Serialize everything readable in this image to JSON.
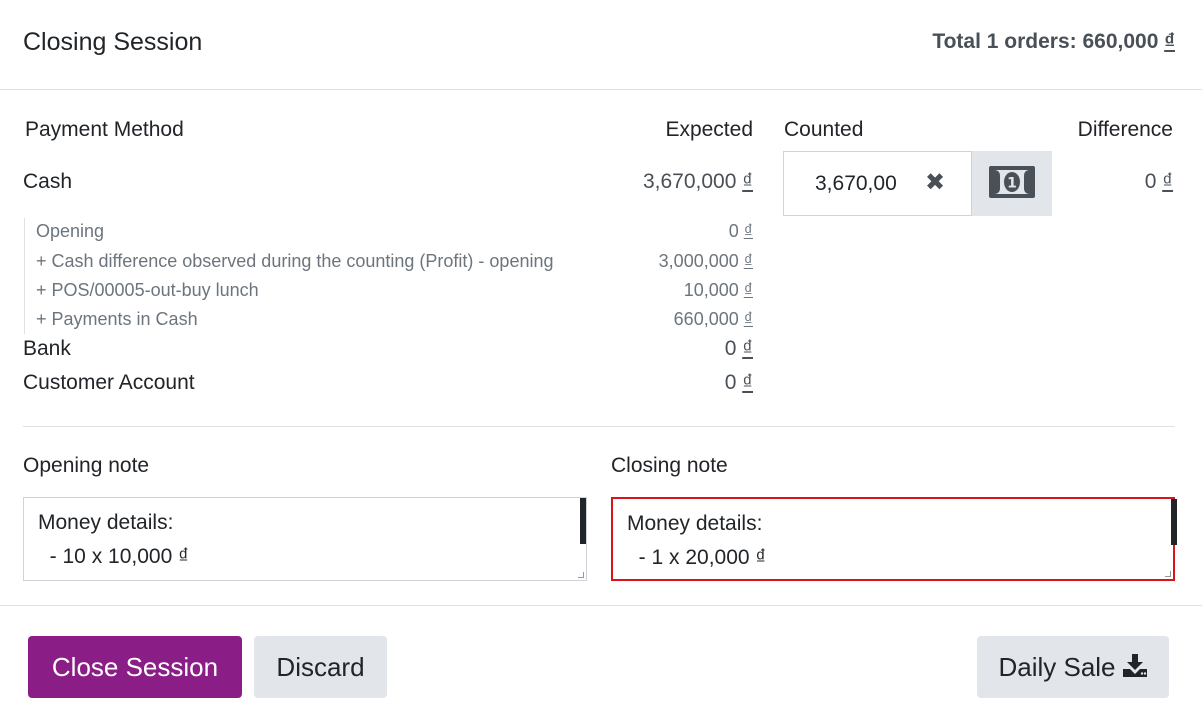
{
  "header": {
    "title": "Closing Session",
    "total": "Total 1 orders: 660,000 ₫"
  },
  "columns": {
    "payment_method": "Payment Method",
    "expected": "Expected",
    "counted": "Counted",
    "difference": "Difference"
  },
  "cash": {
    "name": "Cash",
    "expected": "3,670,000 ₫",
    "counted_value": "3,670,00",
    "difference": "0 ₫",
    "lines": [
      {
        "label": "Opening",
        "amount": "0 ₫"
      },
      {
        "label": "+ Cash difference observed during the counting (Profit) - opening",
        "amount": "3,000,000 ₫"
      },
      {
        "label": "+ POS/00005-out-buy lunch",
        "amount": "10,000 ₫"
      },
      {
        "label": "+ Payments in Cash",
        "amount": "660,000 ₫"
      }
    ]
  },
  "other_methods": [
    {
      "name": "Bank",
      "expected": "0 ₫"
    },
    {
      "name": "Customer Account",
      "expected": "0 ₫"
    }
  ],
  "notes": {
    "opening_label": "Opening note",
    "opening_text": "Money details:\n  - 10 x 10,000 ₫",
    "closing_label": "Closing note",
    "closing_text": "Money details:\n  - 1 x 20,000 ₫"
  },
  "icons": {
    "clear": "times-icon",
    "cash": "money-bill-icon",
    "download": "download-icon"
  },
  "colors": {
    "primary": "#8b1d87",
    "highlight_border": "#d9141c",
    "secondary_button": "#e2e5ea"
  },
  "footer": {
    "close_session": "Close Session",
    "discard": "Discard",
    "daily_sale": "Daily Sale"
  }
}
